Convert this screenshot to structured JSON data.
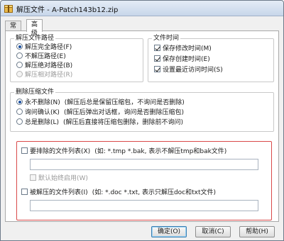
{
  "window": {
    "title": "解压文件 - A-Patch143b12.zip"
  },
  "tabs": [
    {
      "label": "常规"
    },
    {
      "label": "高级"
    }
  ],
  "extract_path": {
    "title": "解压文件路径",
    "options": [
      {
        "label": "解压完全路径(F)",
        "checked": true,
        "enabled": true
      },
      {
        "label": "不解压路径(E)",
        "checked": false,
        "enabled": true
      },
      {
        "label": "解压绝对路径(B)",
        "checked": false,
        "enabled": true
      },
      {
        "label": "解压相对路径(R)",
        "checked": false,
        "enabled": false
      }
    ]
  },
  "file_time": {
    "title": "文件时间",
    "options": [
      {
        "label": "保存修改时间(M)",
        "checked": true
      },
      {
        "label": "保存创建时间(E)",
        "checked": true
      },
      {
        "label": "设置最近访问时间(S)",
        "checked": true
      }
    ]
  },
  "delete_archive": {
    "title": "删除压缩文件",
    "options": [
      {
        "label": "永不删除(N)",
        "note": "(解压后总是保留压缩包，不询问是否删除)",
        "checked": true
      },
      {
        "label": "询问确认(K)",
        "note": "(解压后弹出对话框，询问是否删除压缩包)",
        "checked": false
      },
      {
        "label": "总是删除(L)",
        "note": "(解压后直接将压缩包删除，删除前不询问)",
        "checked": false
      }
    ]
  },
  "exclude": {
    "label": "要排除的文件列表(X)",
    "hint": "(如: *.tmp *.bak, 表示不解压tmp和bak文件)",
    "value": "",
    "default_label": "默认始终启用(W)"
  },
  "include": {
    "label": "被解压的文件列表(I)",
    "hint": "(如: *.doc *.txt, 表示只解压doc和txt文件)",
    "value": ""
  },
  "buttons": {
    "ok": "确定(O)",
    "cancel": "取消(C)",
    "help": "帮助(H)"
  }
}
